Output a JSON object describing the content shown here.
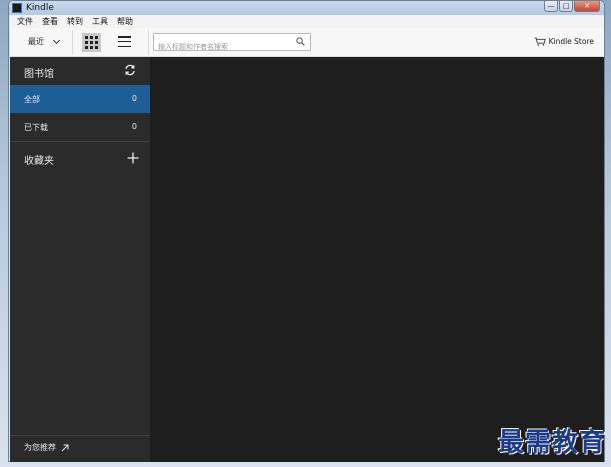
{
  "window": {
    "title": "Kindle",
    "controls": [
      "minimize",
      "maximize",
      "close"
    ]
  },
  "menu": [
    "文件",
    "查看",
    "转到",
    "工具",
    "帮助"
  ],
  "toolbar": {
    "sort_label": "最近",
    "search_placeholder": "输入标题和作者名搜索",
    "store_label": "Kindle Store"
  },
  "sidebar": {
    "library_label": "图书馆",
    "items": [
      {
        "label": "全部",
        "count": "0",
        "active": true
      },
      {
        "label": "已下载",
        "count": "0",
        "active": false
      }
    ],
    "collections_label": "收藏夹",
    "recommend_label": "为您推荐"
  },
  "watermark": "最需教育",
  "colors": {
    "sidebar_bg": "#2b2b2b",
    "active_item": "#1f5d96",
    "content_bg": "#1e1e1e",
    "toolbar_bg": "#f7f7f7"
  }
}
